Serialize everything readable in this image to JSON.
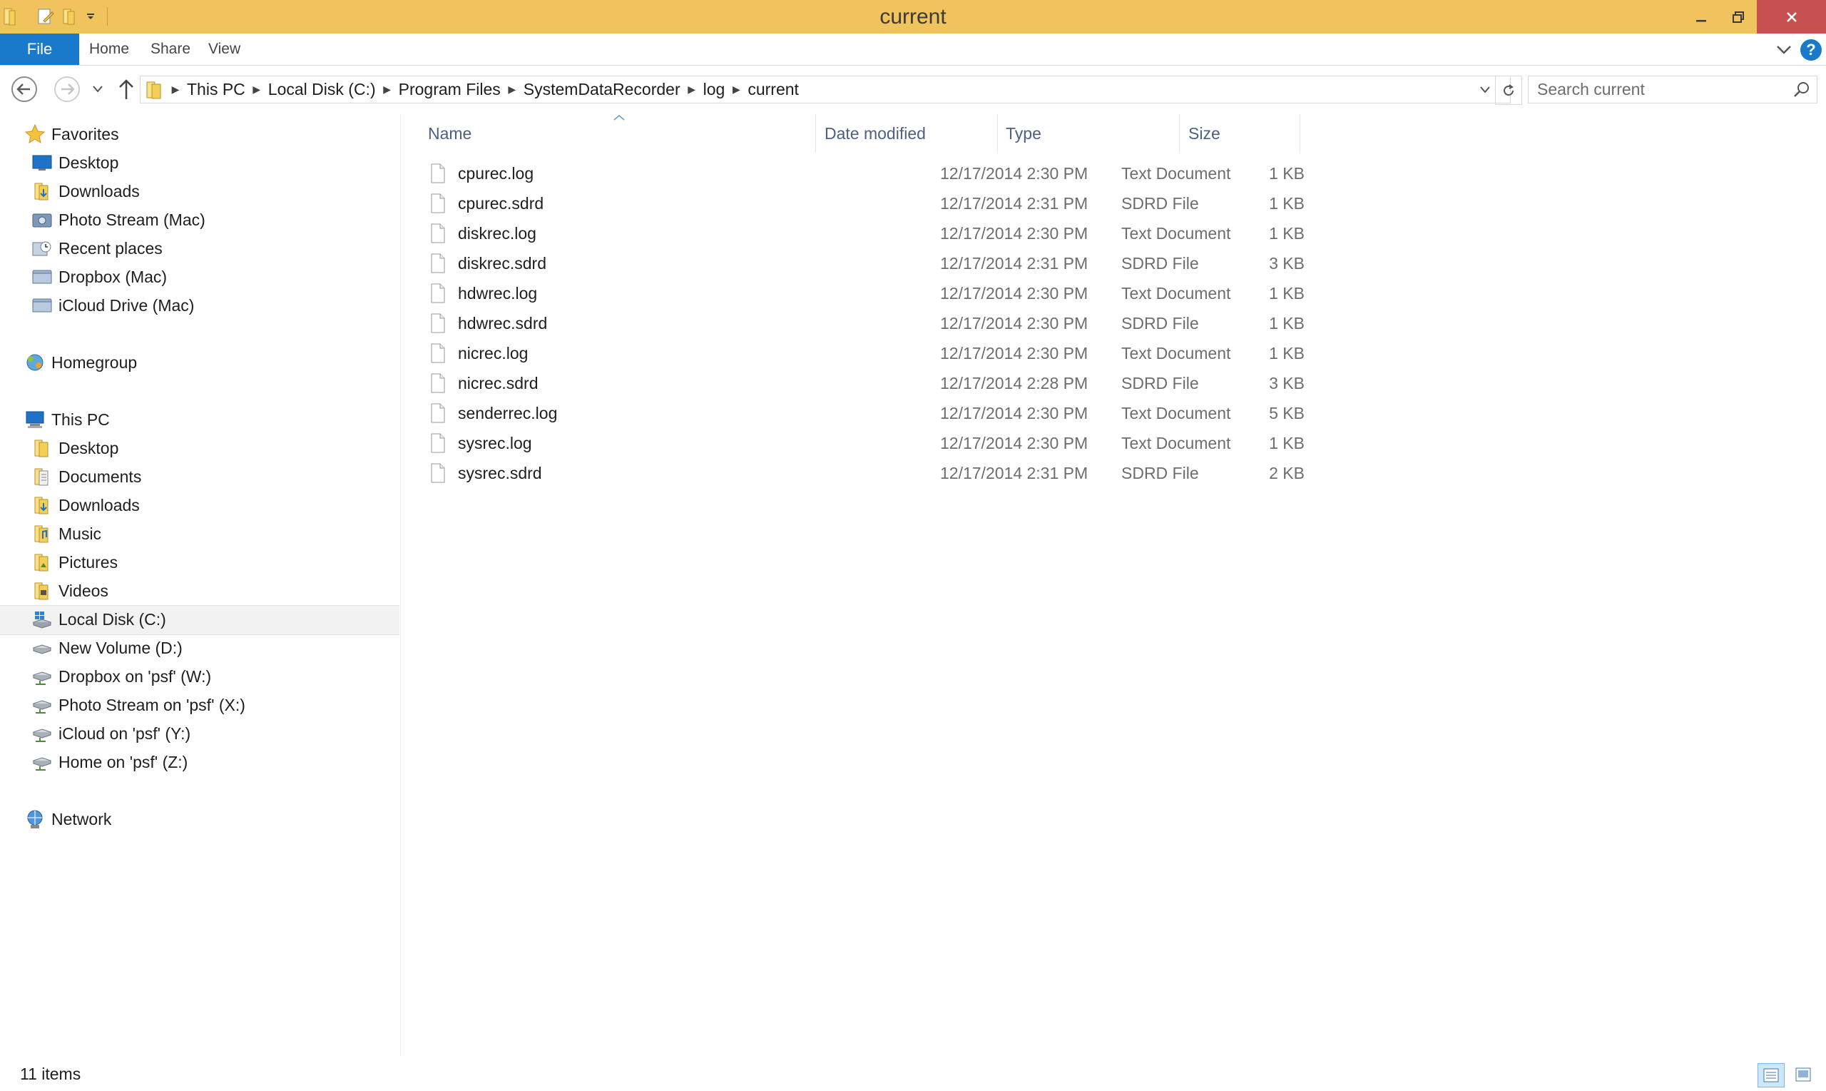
{
  "window": {
    "title": "current",
    "accent": "#f0c35c",
    "close_color": "#c75050"
  },
  "ribbon": {
    "tabs": [
      {
        "label": "File"
      },
      {
        "label": "Home"
      },
      {
        "label": "Share"
      },
      {
        "label": "View"
      }
    ],
    "file_color": "#1979ca"
  },
  "address": {
    "breadcrumbs": [
      "This PC",
      "Local Disk (C:)",
      "Program Files",
      "SystemDataRecorder",
      "log",
      "current"
    ]
  },
  "search": {
    "placeholder": "Search current"
  },
  "sidebar": {
    "favorites": {
      "label": "Favorites",
      "items": [
        {
          "label": "Desktop",
          "icon": "desktop-icon"
        },
        {
          "label": "Downloads",
          "icon": "downloads-icon"
        },
        {
          "label": "Photo Stream (Mac)",
          "icon": "camera-icon"
        },
        {
          "label": "Recent places",
          "icon": "recent-places-icon"
        },
        {
          "label": "Dropbox (Mac)",
          "icon": "folder-icon"
        },
        {
          "label": "iCloud Drive (Mac)",
          "icon": "folder-icon"
        }
      ]
    },
    "homegroup": {
      "label": "Homegroup"
    },
    "this_pc": {
      "label": "This PC",
      "items": [
        {
          "label": "Desktop",
          "icon": "folder-icon"
        },
        {
          "label": "Documents",
          "icon": "documents-icon"
        },
        {
          "label": "Downloads",
          "icon": "downloads-icon"
        },
        {
          "label": "Music",
          "icon": "music-icon"
        },
        {
          "label": "Pictures",
          "icon": "pictures-icon"
        },
        {
          "label": "Videos",
          "icon": "videos-icon"
        },
        {
          "label": "Local Disk (C:)",
          "icon": "windows-drive-icon",
          "selected": true
        },
        {
          "label": "New Volume (D:)",
          "icon": "drive-icon"
        },
        {
          "label": "Dropbox on 'psf' (W:)",
          "icon": "network-drive-icon"
        },
        {
          "label": "Photo Stream on 'psf' (X:)",
          "icon": "network-drive-icon"
        },
        {
          "label": "iCloud on 'psf' (Y:)",
          "icon": "network-drive-icon"
        },
        {
          "label": "Home on 'psf' (Z:)",
          "icon": "network-drive-icon"
        }
      ]
    },
    "network": {
      "label": "Network"
    }
  },
  "columns": {
    "name": "Name",
    "date": "Date modified",
    "type": "Type",
    "size": "Size"
  },
  "files": [
    {
      "name": "cpurec.log",
      "date": "12/17/2014 2:30 PM",
      "type": "Text Document",
      "size": "1 KB"
    },
    {
      "name": "cpurec.sdrd",
      "date": "12/17/2014 2:31 PM",
      "type": "SDRD File",
      "size": "1 KB"
    },
    {
      "name": "diskrec.log",
      "date": "12/17/2014 2:30 PM",
      "type": "Text Document",
      "size": "1 KB"
    },
    {
      "name": "diskrec.sdrd",
      "date": "12/17/2014 2:31 PM",
      "type": "SDRD File",
      "size": "3 KB"
    },
    {
      "name": "hdwrec.log",
      "date": "12/17/2014 2:30 PM",
      "type": "Text Document",
      "size": "1 KB"
    },
    {
      "name": "hdwrec.sdrd",
      "date": "12/17/2014 2:30 PM",
      "type": "SDRD File",
      "size": "1 KB"
    },
    {
      "name": "nicrec.log",
      "date": "12/17/2014 2:30 PM",
      "type": "Text Document",
      "size": "1 KB"
    },
    {
      "name": "nicrec.sdrd",
      "date": "12/17/2014 2:28 PM",
      "type": "SDRD File",
      "size": "3 KB"
    },
    {
      "name": "senderrec.log",
      "date": "12/17/2014 2:30 PM",
      "type": "Text Document",
      "size": "5 KB"
    },
    {
      "name": "sysrec.log",
      "date": "12/17/2014 2:30 PM",
      "type": "Text Document",
      "size": "1 KB"
    },
    {
      "name": "sysrec.sdrd",
      "date": "12/17/2014 2:31 PM",
      "type": "SDRD File",
      "size": "2 KB"
    }
  ],
  "status": {
    "item_count": "11 items"
  }
}
